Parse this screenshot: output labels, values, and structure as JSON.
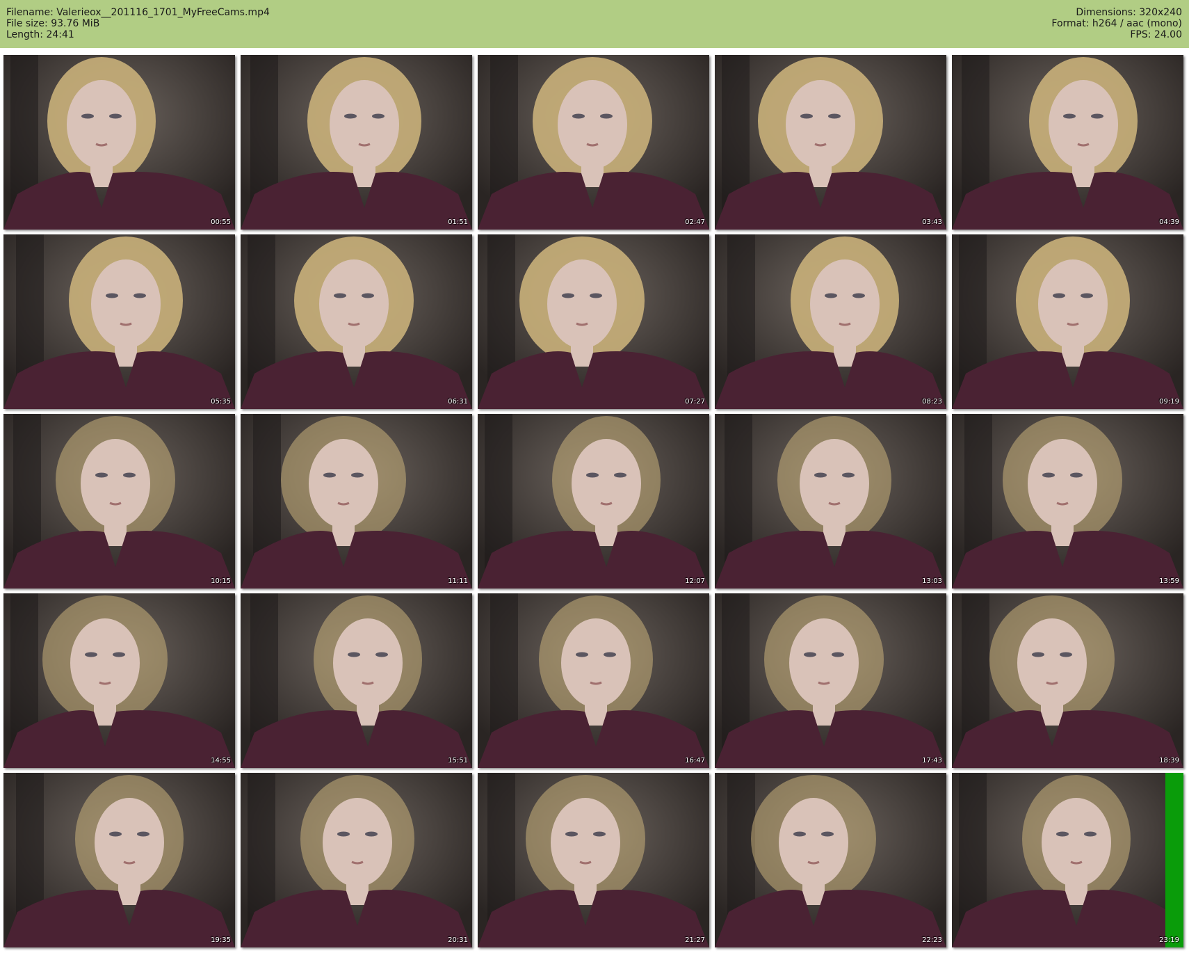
{
  "header": {
    "filename": "Filename: Valerieox__201116_1701_MyFreeCams.mp4",
    "filesize": "File size: 93.76 MiB",
    "length": "Length: 24:41",
    "dimensions": "Dimensions: 320x240",
    "format": "Format: h264 / aac (mono)",
    "fps": "FPS: 24.00"
  },
  "thumbnails": [
    {
      "timestamp": "00:55"
    },
    {
      "timestamp": "01:51"
    },
    {
      "timestamp": "02:47"
    },
    {
      "timestamp": "03:43"
    },
    {
      "timestamp": "04:39"
    },
    {
      "timestamp": "05:35"
    },
    {
      "timestamp": "06:31"
    },
    {
      "timestamp": "07:27"
    },
    {
      "timestamp": "08:23"
    },
    {
      "timestamp": "09:19"
    },
    {
      "timestamp": "10:15"
    },
    {
      "timestamp": "11:11"
    },
    {
      "timestamp": "12:07"
    },
    {
      "timestamp": "13:03"
    },
    {
      "timestamp": "13:59"
    },
    {
      "timestamp": "14:55"
    },
    {
      "timestamp": "15:51"
    },
    {
      "timestamp": "16:47"
    },
    {
      "timestamp": "17:43"
    },
    {
      "timestamp": "18:39"
    },
    {
      "timestamp": "19:35"
    },
    {
      "timestamp": "20:31"
    },
    {
      "timestamp": "21:27"
    },
    {
      "timestamp": "22:23"
    },
    {
      "timestamp": "23:19"
    }
  ],
  "colors": {
    "header_bg": "#b1cd84",
    "sweater": "#4a2233",
    "hair": "#c9b07a",
    "skin": "#d9c2b8",
    "wall": "#4a4440",
    "green_bar": "#0a9c0a"
  }
}
